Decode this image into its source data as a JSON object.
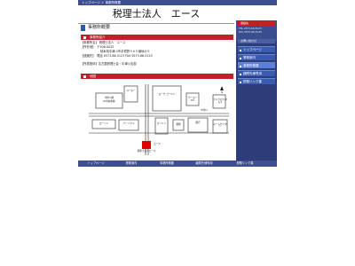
{
  "breadcrumb": "トップページ ＞ 事務所概要",
  "site_title": "税理士法人　エース",
  "page_heading": "事務所概要",
  "sections": {
    "office_info": "事務所紹介",
    "access": "地図"
  },
  "info": {
    "name": "【事務所名】 税理士法人　エース",
    "address_label": "【所在地】",
    "postal": "〒506-0025",
    "address": "岐阜県中津川市手賀野５６５番地の５",
    "contact": "【連絡先】　電話 0573-66-5123 FAX 0573-66-5125",
    "association": "【所属団体】名古屋税理士会・中津川支部"
  },
  "map": {
    "labels": [
      "中津川駅",
      "JR中央本線",
      "ユーホー",
      "ヨーク ゴールド",
      "ケーヨーD2",
      "パーソナル",
      "ローソン",
      "ガソリン",
      "郵便",
      "銀行",
      "ホームセンター",
      "カメラのキタムラ",
      "エース",
      "N",
      "中津川",
      "税理士法人エース"
    ]
  },
  "sidebar": {
    "contact": {
      "heading": "連絡先",
      "tel": "TEL 0573-66-5123",
      "fax": "FAX 0573-66-5125"
    },
    "contact_link": "お問い合わせ",
    "nav": [
      {
        "label": "トップページ",
        "active": false
      },
      {
        "label": "業務案内",
        "active": false
      },
      {
        "label": "事務所概要",
        "active": true
      },
      {
        "label": "顧問先様専用",
        "active": false
      },
      {
        "label": "税務リンク集",
        "active": false
      }
    ]
  },
  "footer_nav": [
    "トップページ",
    "業務案内",
    "事務所概要",
    "顧問先様専用",
    "税務リンク集"
  ],
  "colors": {
    "accent_red": "#c0202a",
    "nav_blue": "#3a5bb0",
    "dark_blue": "#2d3d7a"
  }
}
